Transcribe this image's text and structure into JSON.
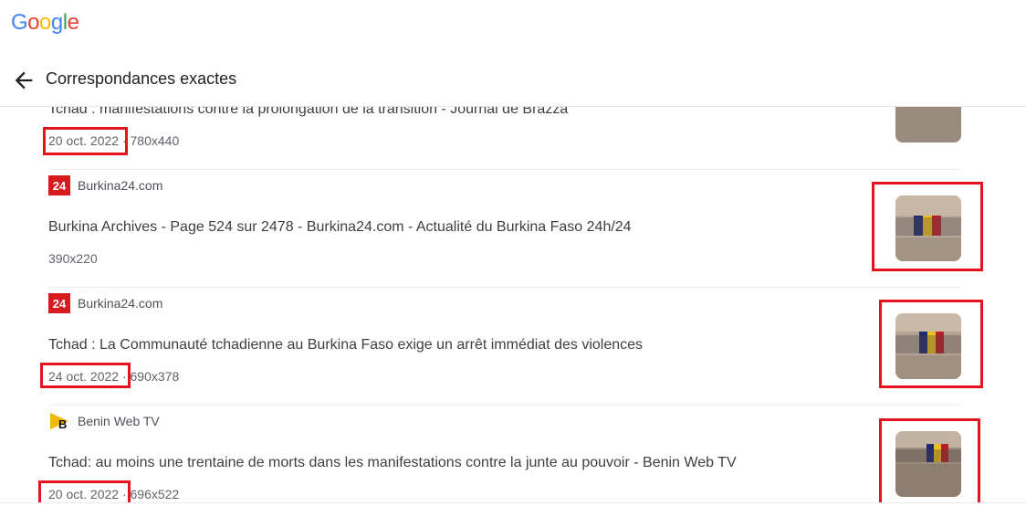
{
  "logo": {
    "letters": [
      "G",
      "o",
      "o",
      "g",
      "l",
      "e"
    ],
    "colors": [
      "#4285F4",
      "#EA4335",
      "#FBBC05",
      "#4285F4",
      "#34A853",
      "#EA4335"
    ]
  },
  "header": {
    "back_icon": "arrow-left-icon",
    "title": "Correspondances exactes"
  },
  "results": [
    {
      "source": "",
      "title": "Tchad : manifestations contre la prolongation de la transition - Journal de Brazza",
      "date": "20 oct. 2022",
      "size": "780x440"
    },
    {
      "source": "Burkina24.com",
      "icon": "burkina24-logo",
      "title": "Burkina Archives - Page 524 sur 2478 - Burkina24.com - Actualité du Burkina Faso 24h/24",
      "date": "",
      "size": "390x220"
    },
    {
      "source": "Burkina24.com",
      "icon": "burkina24-logo",
      "title": "Tchad : La Communauté tchadienne au Burkina Faso exige un arrêt immédiat des violences",
      "date": "24 oct. 2022",
      "size": "690x378"
    },
    {
      "source": "Benin Web TV",
      "icon": "beninwebtv-logo",
      "title": "Tchad: au moins une trentaine de morts dans les manifestations contre la junte au pouvoir - Benin Web TV",
      "date": "20 oct. 2022",
      "size": "696x522"
    }
  ],
  "accent": {
    "highlight": "#e3141f"
  }
}
